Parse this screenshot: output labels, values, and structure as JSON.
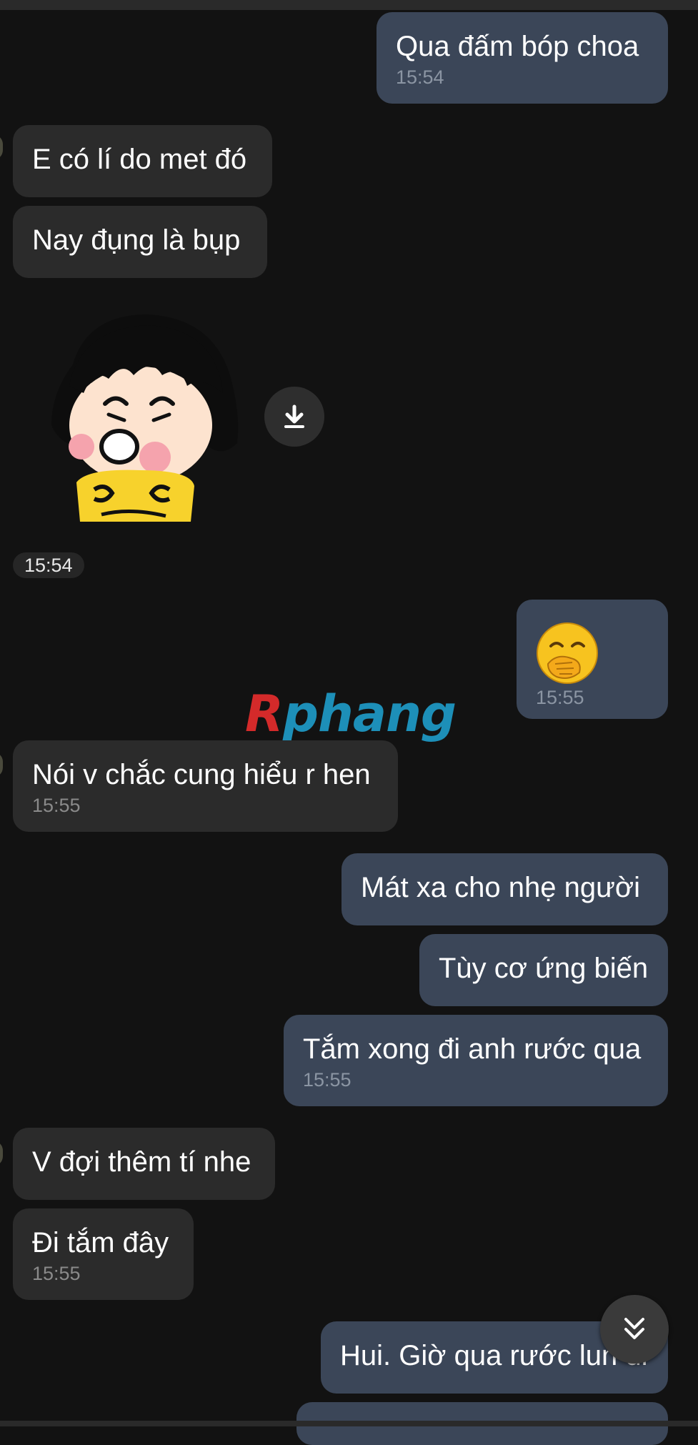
{
  "messages": {
    "m1": {
      "text": "Qua đấm bóp choa",
      "time": "15:54"
    },
    "m2": {
      "text": "E có lí do met đó"
    },
    "m3": {
      "text": "Nay đụng là bụp"
    },
    "sticker_time": "15:54",
    "m4": {
      "time": "15:55"
    },
    "m5": {
      "text": "Nói v chắc cung hiểu r hen",
      "time": "15:55"
    },
    "m6": {
      "text": "Mát xa cho nhẹ người"
    },
    "m7": {
      "text": "Tùy cơ ứng biến"
    },
    "m8": {
      "text": "Tắm xong đi anh rước qua",
      "time": "15:55"
    },
    "m9": {
      "text": "V đợi thêm tí nhe"
    },
    "m10": {
      "text": "Đi tắm đây",
      "time": "15:55"
    },
    "m11": {
      "text": "Hui. Giờ qua rước lun đi"
    }
  },
  "watermark": {
    "first": "R",
    "rest": "phang"
  },
  "icons": {
    "download": "download-icon",
    "scroll_down": "double-chevron-down-icon",
    "emoji": "face-with-hand-over-mouth-emoji"
  },
  "colors": {
    "background": "#121212",
    "outgoing_bubble": "#3b4658",
    "incoming_bubble": "#2b2b2b"
  }
}
